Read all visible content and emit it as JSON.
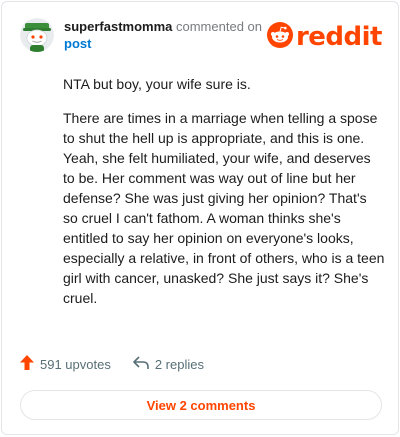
{
  "comment": {
    "username": "superfastmomma",
    "action": "commented on",
    "target": "post",
    "paragraphs": [
      "NTA but boy, your wife sure is.",
      "There are times in a marriage when telling a spose to shut the hell up is appropriate, and this is one. Yeah, she felt humiliated, your wife, and deserves to be. Her comment was way out of line but her defense? She was just giving her opinion? That's so cruel I can't fathom. A woman thinks she's entitled to say her opinion on everyone's looks, especially a relative, in front of others, who is a teen girl with cancer, unasked? She just says it? She's cruel."
    ]
  },
  "brand": {
    "wordmark": "reddit",
    "color": "#ff4500"
  },
  "actions": {
    "upvotes": "591 upvotes",
    "replies": "2 replies"
  },
  "view_button": "View 2 comments",
  "icons": {
    "avatar": "snoo-avatar-icon",
    "logo": "reddit-logo-icon",
    "upvote": "upvote-arrow-icon",
    "reply": "reply-arrow-icon"
  }
}
